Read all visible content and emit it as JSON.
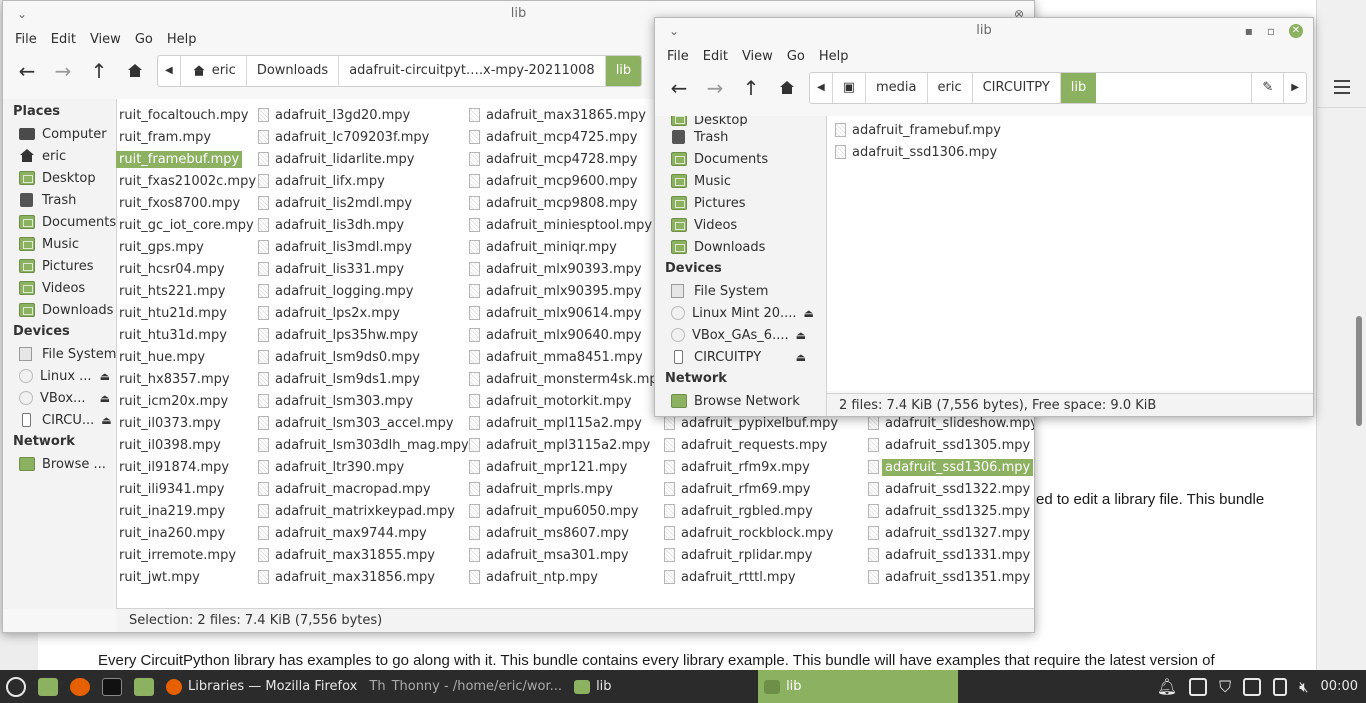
{
  "browser": {
    "page_line1": "ed to edit a library file. This bundle",
    "page_line2": "Every CircuitPython library has examples to go along with it. This bundle contains every library example. This bundle will have examples that require the latest version of"
  },
  "back_window": {
    "title": "lib",
    "menu": [
      "File",
      "Edit",
      "View",
      "Go",
      "Help"
    ],
    "path": [
      "eric",
      "Downloads",
      "adafruit-circuitpyt….x-mpy-20211008",
      "lib"
    ],
    "sidebar": {
      "places_label": "Places",
      "places": [
        "Computer",
        "eric",
        "Desktop",
        "Trash",
        "Documents",
        "Music",
        "Pictures",
        "Videos",
        "Downloads"
      ],
      "devices_label": "Devices",
      "devices": [
        "File System",
        "Linux ...",
        "VBox...",
        "CIRCU..."
      ],
      "network_label": "Network",
      "network": [
        "Browse ..."
      ]
    },
    "columns": [
      [
        "ruit_focaltouch.mpy",
        "ruit_fram.mpy",
        "ruit_framebuf.mpy",
        "ruit_fxas21002c.mpy",
        "ruit_fxos8700.mpy",
        "ruit_gc_iot_core.mpy",
        "ruit_gps.mpy",
        "ruit_hcsr04.mpy",
        "ruit_hts221.mpy",
        "ruit_htu21d.mpy",
        "ruit_htu31d.mpy",
        "ruit_hue.mpy",
        "ruit_hx8357.mpy",
        "ruit_icm20x.mpy",
        "ruit_il0373.mpy",
        "ruit_il0398.mpy",
        "ruit_il91874.mpy",
        "ruit_ili9341.mpy",
        "ruit_ina219.mpy",
        "ruit_ina260.mpy",
        "ruit_irremote.mpy",
        "ruit_jwt.mpy"
      ],
      [
        "adafruit_l3gd20.mpy",
        "adafruit_lc709203f.mpy",
        "adafruit_lidarlite.mpy",
        "adafruit_lifx.mpy",
        "adafruit_lis2mdl.mpy",
        "adafruit_lis3dh.mpy",
        "adafruit_lis3mdl.mpy",
        "adafruit_lis331.mpy",
        "adafruit_logging.mpy",
        "adafruit_lps2x.mpy",
        "adafruit_lps35hw.mpy",
        "adafruit_lsm9ds0.mpy",
        "adafruit_lsm9ds1.mpy",
        "adafruit_lsm303.mpy",
        "adafruit_lsm303_accel.mpy",
        "adafruit_lsm303dlh_mag.mpy",
        "adafruit_ltr390.mpy",
        "adafruit_macropad.mpy",
        "adafruit_matrixkeypad.mpy",
        "adafruit_max9744.mpy",
        "adafruit_max31855.mpy",
        "adafruit_max31856.mpy"
      ],
      [
        "adafruit_max31865.mpy",
        "adafruit_mcp4725.mpy",
        "adafruit_mcp4728.mpy",
        "adafruit_mcp9600.mpy",
        "adafruit_mcp9808.mpy",
        "adafruit_miniesptool.mpy",
        "adafruit_miniqr.mpy",
        "adafruit_mlx90393.mpy",
        "adafruit_mlx90395.mpy",
        "adafruit_mlx90614.mpy",
        "adafruit_mlx90640.mpy",
        "adafruit_mma8451.mpy",
        "adafruit_monsterm4sk.mpy",
        "adafruit_motorkit.mpy",
        "adafruit_mpl115a2.mpy",
        "adafruit_mpl3115a2.mpy",
        "adafruit_mpr121.mpy",
        "adafruit_mprls.mpy",
        "adafruit_mpu6050.mpy",
        "adafruit_ms8607.mpy",
        "adafruit_msa301.mpy",
        "adafruit_ntp.mpy"
      ],
      [
        "adafruit_pypixelbuf.mpy",
        "adafruit_requests.mpy",
        "adafruit_rfm9x.mpy",
        "adafruit_rfm69.mpy",
        "adafruit_rgbled.mpy",
        "adafruit_rockblock.mpy",
        "adafruit_rplidar.mpy",
        "adafruit_rtttl.mpy"
      ],
      [
        "adafruit_slideshow.mpy",
        "adafruit_ssd1305.mpy",
        "adafruit_ssd1306.mpy",
        "adafruit_ssd1322.mpy",
        "adafruit_ssd1325.mpy",
        "adafruit_ssd1327.mpy",
        "adafruit_ssd1331.mpy",
        "adafruit_ssd1351.mpy"
      ]
    ],
    "status": "Selection: 2 files: 7.4 KiB (7,556 bytes)"
  },
  "front_window": {
    "title": "lib",
    "menu": [
      "File",
      "Edit",
      "View",
      "Go",
      "Help"
    ],
    "path": [
      "media",
      "eric",
      "CIRCUITPY",
      "lib"
    ],
    "sidebar": {
      "places_partial": "Desktop",
      "places": [
        "Trash",
        "Documents",
        "Music",
        "Pictures",
        "Videos",
        "Downloads"
      ],
      "devices_label": "Devices",
      "devices": [
        "File System",
        "Linux Mint 20....",
        "VBox_GAs_6....",
        "CIRCUITPY"
      ],
      "network_label": "Network",
      "network": [
        "Browse Network"
      ]
    },
    "files": [
      "adafruit_framebuf.mpy",
      "adafruit_ssd1306.mpy"
    ],
    "status": "2 files: 7.4 KiB (7,556 bytes), Free space: 9.0 KiB"
  },
  "taskbar": {
    "firefox_label": "Libraries — Mozilla Firefox",
    "thonny_label": "Thonny  -  /home/eric/wor...",
    "lib1_label": "lib",
    "lib2_label": "lib",
    "clock": "00:00"
  },
  "colors": {
    "accent": "#8cb261",
    "taskbar": "#2b2b2b"
  }
}
